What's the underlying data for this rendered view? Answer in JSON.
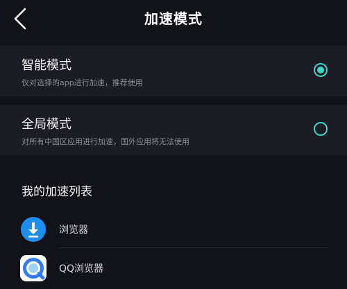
{
  "header": {
    "back_icon": "chevron-left-icon",
    "title": "加速模式"
  },
  "modes": [
    {
      "title": "智能模式",
      "description": "仅对选择的app进行加速，推荐使用",
      "selected": true
    },
    {
      "title": "全局模式",
      "description": "对所有中国区应用进行加速，国外应用将无法使用",
      "selected": false
    }
  ],
  "accent_color": "#37d6c9",
  "accel_list": {
    "title": "我的加速列表",
    "apps": [
      {
        "name": "浏览器",
        "icon": "browser-download-icon",
        "icon_color": "#1f8ef1"
      },
      {
        "name": "QQ浏览器",
        "icon": "qq-browser-icon",
        "icon_color": "#2f7cf6"
      }
    ]
  }
}
